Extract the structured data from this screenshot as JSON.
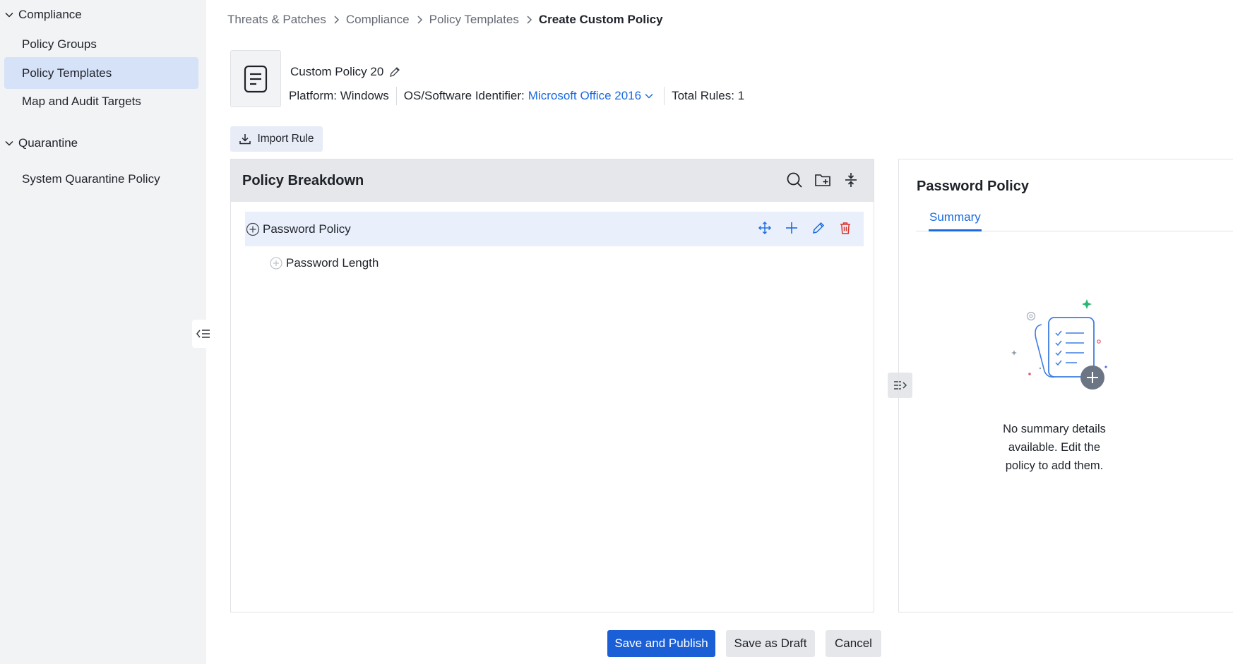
{
  "sidebar": {
    "sections": [
      {
        "label": "Compliance",
        "items": [
          {
            "label": "Policy Groups",
            "active": false
          },
          {
            "label": "Policy Templates",
            "active": true
          },
          {
            "label": "Map and Audit Targets",
            "active": false
          }
        ]
      },
      {
        "label": "Quarantine",
        "items": [
          {
            "label": "System Quarantine Policy",
            "active": false
          }
        ]
      }
    ]
  },
  "breadcrumb": [
    "Threats & Patches",
    "Compliance",
    "Policy Templates",
    "Create Custom Policy"
  ],
  "policy": {
    "name": "Custom Policy 20",
    "platform_label": "Platform:",
    "platform_value": "Windows",
    "identifier_label": "OS/Software Identifier:",
    "identifier_value": "Microsoft Office 2016",
    "total_rules_label": "Total Rules:",
    "total_rules_value": "1"
  },
  "toolbar": {
    "import_label": "Import Rule"
  },
  "breakdown": {
    "title": "Policy Breakdown",
    "rows": [
      {
        "label": "Password Policy"
      },
      {
        "label": "Password Length"
      }
    ]
  },
  "details": {
    "title": "Password Policy",
    "tab": "Summary",
    "empty_line1": "No summary details",
    "empty_line2": "available. Edit the",
    "empty_line3": "policy to add them."
  },
  "footer": {
    "publish_label": "Save and Publish",
    "draft_label": "Save as Draft",
    "cancel_label": "Cancel"
  },
  "colors": {
    "accent": "#1a6ae0",
    "primary_button": "#1a5fd6",
    "delete": "#d9342b",
    "active_nav": "#d5e2f8"
  }
}
